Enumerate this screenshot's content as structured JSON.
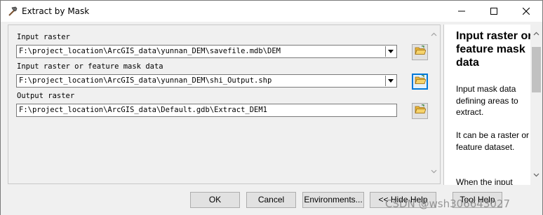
{
  "window": {
    "title": "Extract by Mask",
    "app_icon": "hammer-icon",
    "controls": {
      "minimize": "minimize-icon",
      "maximize": "maximize-icon",
      "close": "close-icon"
    }
  },
  "form": {
    "fields": [
      {
        "label": "Input raster",
        "value": "F:\\project_location\\ArcGIS_data\\yunnan_DEM\\savefile.mdb\\DEM",
        "has_dropdown": true
      },
      {
        "label": "Input raster or feature mask data",
        "value": "F:\\project_location\\ArcGIS_data\\yunnan_DEM\\shi_Output.shp",
        "has_dropdown": true
      },
      {
        "label": "Output raster",
        "value": "F:\\project_location\\ArcGIS_data\\Default.gdb\\Extract_DEM1",
        "has_dropdown": false
      }
    ],
    "browse_icon": "open-folder-icon"
  },
  "help": {
    "title": "Input raster or feature mask data",
    "paragraphs": [
      "Input mask data defining areas to extract.",
      "It can be a raster or feature dataset.",
      "When the input"
    ]
  },
  "buttons": {
    "ok": "OK",
    "cancel": "Cancel",
    "environments": "Environments...",
    "hide_help": "<< Hide Help",
    "tool_help": "Tool Help"
  },
  "watermark": "CSDN @wsh306643027",
  "colors": {
    "focus": "#0078d7",
    "folder": "#e8b53a"
  }
}
